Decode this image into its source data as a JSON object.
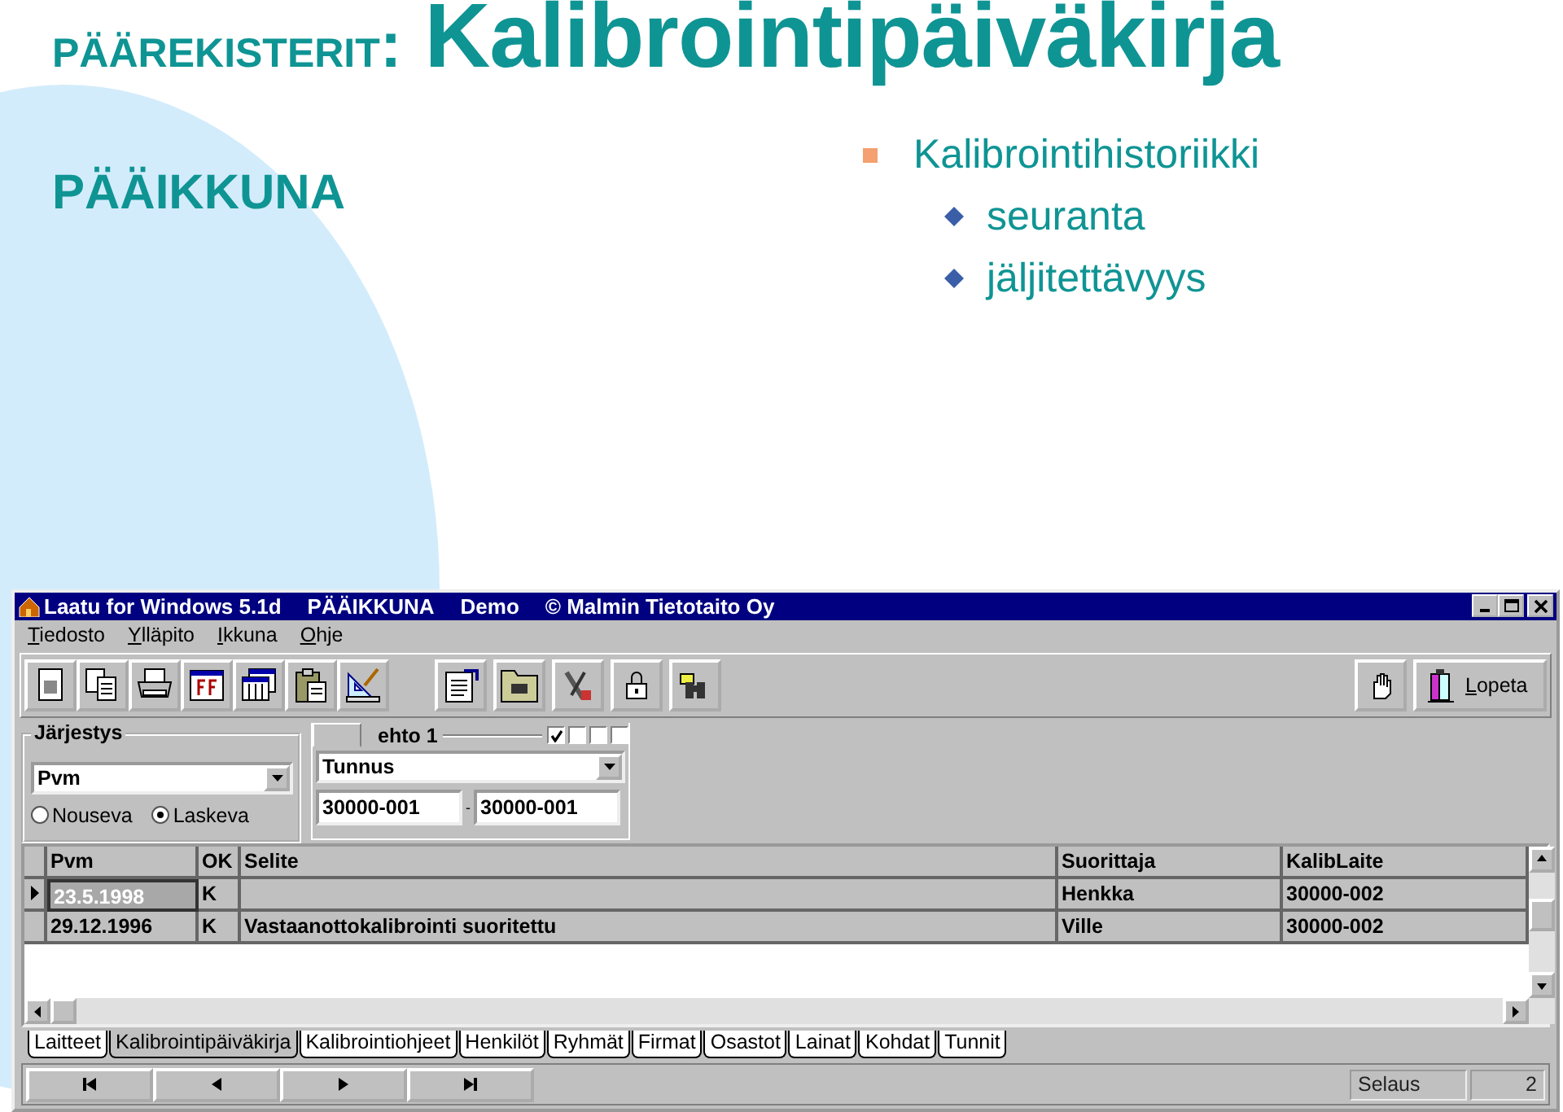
{
  "slide": {
    "title_prefix": "PÄÄREKISTERIT",
    "title_separator": ":",
    "title": "Kalibrointipäiväkirja",
    "subtitle": "PÄÄIKKUNA",
    "bullets": [
      {
        "text": "Kalibrointihistoriikki",
        "children": [
          {
            "text": "seuranta"
          },
          {
            "text": "jäljitettävyys"
          }
        ]
      }
    ]
  },
  "window": {
    "title_parts": [
      "Laatu for Windows 5.1d",
      "PÄÄIKKUNA",
      "Demo",
      "© Malmin Tietotaito Oy"
    ],
    "menu": [
      "Tiedosto",
      "Ylläpito",
      "Ikkuna",
      "Ohje"
    ],
    "toolbar": {
      "exit_button": "Lopeta"
    },
    "sort": {
      "label": "Järjestys",
      "field": "Pvm",
      "options": [
        {
          "label": "Nouseva",
          "selected": false
        },
        {
          "label": "Laskeva",
          "selected": true
        }
      ]
    },
    "condition": {
      "label": "ehto 1",
      "checkboxes": [
        {
          "checked": true
        },
        {
          "checked": false
        },
        {
          "checked": false
        },
        {
          "checked": false
        }
      ],
      "field": "Tunnus",
      "from": "30000-001",
      "range_separator": "-",
      "to": "30000-001"
    },
    "table": {
      "columns": [
        "Pvm",
        "OK",
        "Selite",
        "Suorittaja",
        "KalibLaite"
      ],
      "rows": [
        {
          "cells": [
            "23.5.1998",
            "K",
            null,
            "Henkka",
            "30000-002"
          ],
          "selected": true
        },
        {
          "cells": [
            "29.12.1996",
            "K",
            "Vastaanottokalibrointi suoritettu",
            "Ville",
            "30000-002"
          ],
          "selected": false
        }
      ]
    },
    "tabs": [
      {
        "label": "Laitteet",
        "selected": false
      },
      {
        "label": "Kalibrointipäiväkirja",
        "selected": true
      },
      {
        "label": "Kalibrointiohjeet",
        "selected": false
      },
      {
        "label": "Henkilöt",
        "selected": false
      },
      {
        "label": "Ryhmät",
        "selected": false
      },
      {
        "label": "Firmat",
        "selected": false
      },
      {
        "label": "Osastot",
        "selected": false
      },
      {
        "label": "Lainat",
        "selected": false
      },
      {
        "label": "Kohdat",
        "selected": false
      },
      {
        "label": "Tunnit",
        "selected": false
      }
    ],
    "status_bar": {
      "mode": "Selaus",
      "count": "2"
    }
  }
}
